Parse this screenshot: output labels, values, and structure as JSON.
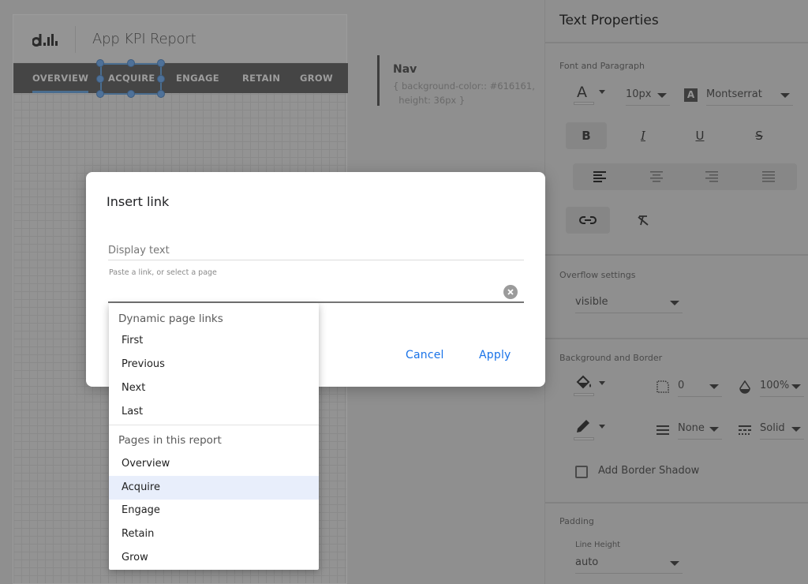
{
  "report": {
    "title": "App KPI Report",
    "logo_icon": "datalabs-bars-logo",
    "nav_tabs": [
      {
        "label": "OVERVIEW",
        "active": true
      },
      {
        "label": "ACQUIRE",
        "selected": true
      },
      {
        "label": "ENGAGE"
      },
      {
        "label": "RETAIN"
      },
      {
        "label": "GROW"
      }
    ]
  },
  "annotation": {
    "title": "Nav",
    "code": "{ background-color:: #616161,\n  height: 36px }"
  },
  "properties_panel": {
    "title": "Text Properties",
    "font_paragraph": {
      "label": "Font and Paragraph",
      "font_color_icon": "text-color-icon",
      "font_size": "10px",
      "font_family_icon": "font-family-icon",
      "font_family": "Montserrat",
      "format_buttons": [
        {
          "name": "bold",
          "glyph": "B",
          "pressed": true
        },
        {
          "name": "italic",
          "glyph": "I",
          "pressed": false
        },
        {
          "name": "underline",
          "glyph": "U",
          "pressed": false
        },
        {
          "name": "strikethrough",
          "glyph": "S",
          "pressed": false
        }
      ],
      "alignments": [
        "left",
        "center",
        "right",
        "justify"
      ],
      "active_alignment": "left",
      "link_icon": "link-icon",
      "clear_format_icon": "clear-formatting-icon"
    },
    "overflow": {
      "label": "Overflow settings",
      "value": "visible"
    },
    "background_border": {
      "label": "Background and Border",
      "fill_icon": "paint-bucket-icon",
      "radius_icon": "border-radius-icon",
      "radius": "0",
      "opacity_icon": "opacity-icon",
      "opacity": "100%",
      "border_color_icon": "pencil-icon",
      "border_weight_icon": "line-weight-icon",
      "border_weight": "None",
      "border_style_icon": "line-style-icon",
      "border_style": "Solid",
      "shadow_label": "Add Border Shadow",
      "shadow_checked": false
    },
    "padding": {
      "label": "Padding",
      "line_height_label": "Line Height",
      "line_height": "auto"
    }
  },
  "dialog": {
    "title": "Insert link",
    "display_text_placeholder": "Display text",
    "display_text_value": "",
    "link_label": "Paste a link, or select a page",
    "link_value": "",
    "clear_icon": "clear-icon",
    "cancel_label": "Cancel",
    "apply_label": "Apply"
  },
  "page_menu": {
    "dynamic_header": "Dynamic page links",
    "dynamic_items": [
      "First",
      "Previous",
      "Next",
      "Last"
    ],
    "pages_header": "Pages in this report",
    "page_items": [
      "Overview",
      "Acquire",
      "Engage",
      "Retain",
      "Grow"
    ],
    "highlighted": "Acquire"
  },
  "colors": {
    "accent": "#1a73e8",
    "nav_bg": "#616161",
    "selection": "#4a6d8f",
    "menu_highlight": "#e8eefb"
  }
}
